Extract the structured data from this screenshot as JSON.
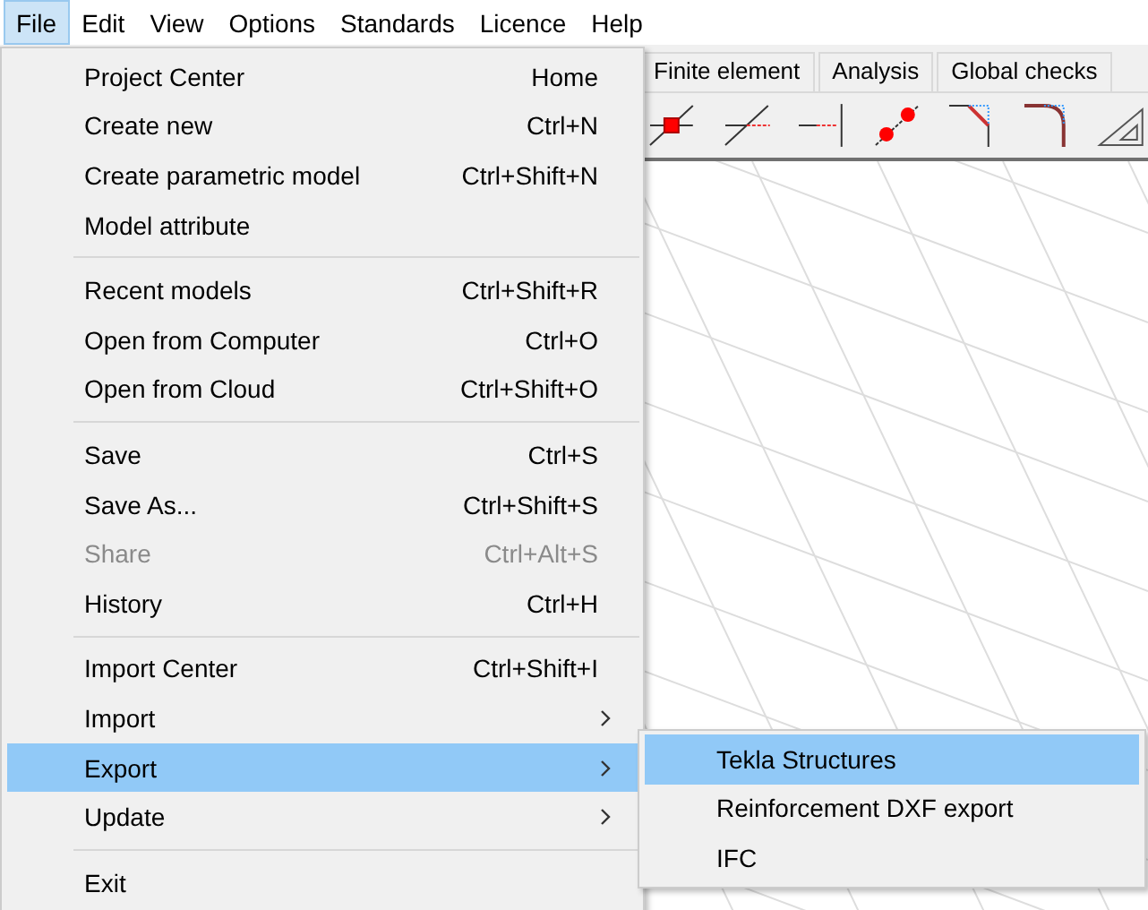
{
  "menu_bar": [
    {
      "label": "File",
      "selected": true
    },
    {
      "label": "Edit",
      "selected": false
    },
    {
      "label": "View",
      "selected": false
    },
    {
      "label": "Options",
      "selected": false
    },
    {
      "label": "Standards",
      "selected": false
    },
    {
      "label": "Licence",
      "selected": false
    },
    {
      "label": "Help",
      "selected": false
    }
  ],
  "tabs": [
    {
      "label": "Finite element",
      "selected": false
    },
    {
      "label": "Analysis",
      "selected": false
    },
    {
      "label": "Global checks",
      "selected": false
    }
  ],
  "file_menu": {
    "groups": [
      {
        "items": [
          {
            "label": "Project Center",
            "shortcut": "Home",
            "kind": "item",
            "disabled": false,
            "selected": false
          },
          {
            "label": "Create new",
            "shortcut": "Ctrl+N",
            "kind": "item",
            "disabled": false,
            "selected": false
          },
          {
            "label": "Create parametric model",
            "shortcut": "Ctrl+Shift+N",
            "kind": "item",
            "disabled": false,
            "selected": false
          },
          {
            "label": "Model attribute",
            "kind": "item",
            "disabled": false,
            "selected": false
          }
        ]
      },
      {
        "items": [
          {
            "label": "Recent models",
            "shortcut": "Ctrl+Shift+R",
            "kind": "item",
            "disabled": false,
            "selected": false
          },
          {
            "label": "Open from Computer",
            "shortcut": "Ctrl+O",
            "kind": "item",
            "disabled": false,
            "selected": false
          },
          {
            "label": "Open from Cloud",
            "shortcut": "Ctrl+Shift+O",
            "kind": "item",
            "disabled": false,
            "selected": false
          }
        ]
      },
      {
        "items": [
          {
            "label": "Save",
            "shortcut": "Ctrl+S",
            "kind": "item",
            "disabled": false,
            "selected": false
          },
          {
            "label": "Save As...",
            "shortcut": "Ctrl+Shift+S",
            "kind": "item",
            "disabled": false,
            "selected": false
          },
          {
            "label": "Share",
            "shortcut": "Ctrl+Alt+S",
            "kind": "item",
            "disabled": true,
            "selected": false
          },
          {
            "label": "History",
            "shortcut": "Ctrl+H",
            "kind": "item",
            "disabled": false,
            "selected": false
          }
        ]
      },
      {
        "items": [
          {
            "label": "Import Center",
            "shortcut": "Ctrl+Shift+I",
            "kind": "item",
            "disabled": false,
            "selected": false
          },
          {
            "label": "Import",
            "kind": "submenu",
            "disabled": false,
            "selected": false
          },
          {
            "label": "Export",
            "kind": "submenu",
            "disabled": false,
            "selected": true
          },
          {
            "label": "Update",
            "kind": "submenu",
            "disabled": false,
            "selected": false
          }
        ]
      },
      {
        "items": [
          {
            "label": "Exit",
            "kind": "item",
            "disabled": false,
            "selected": false
          }
        ]
      }
    ]
  },
  "export_submenu": [
    {
      "label": "Tekla Structures",
      "selected": true
    },
    {
      "label": "Reinforcement DXF export",
      "selected": false
    },
    {
      "label": "IFC",
      "selected": false
    }
  ]
}
